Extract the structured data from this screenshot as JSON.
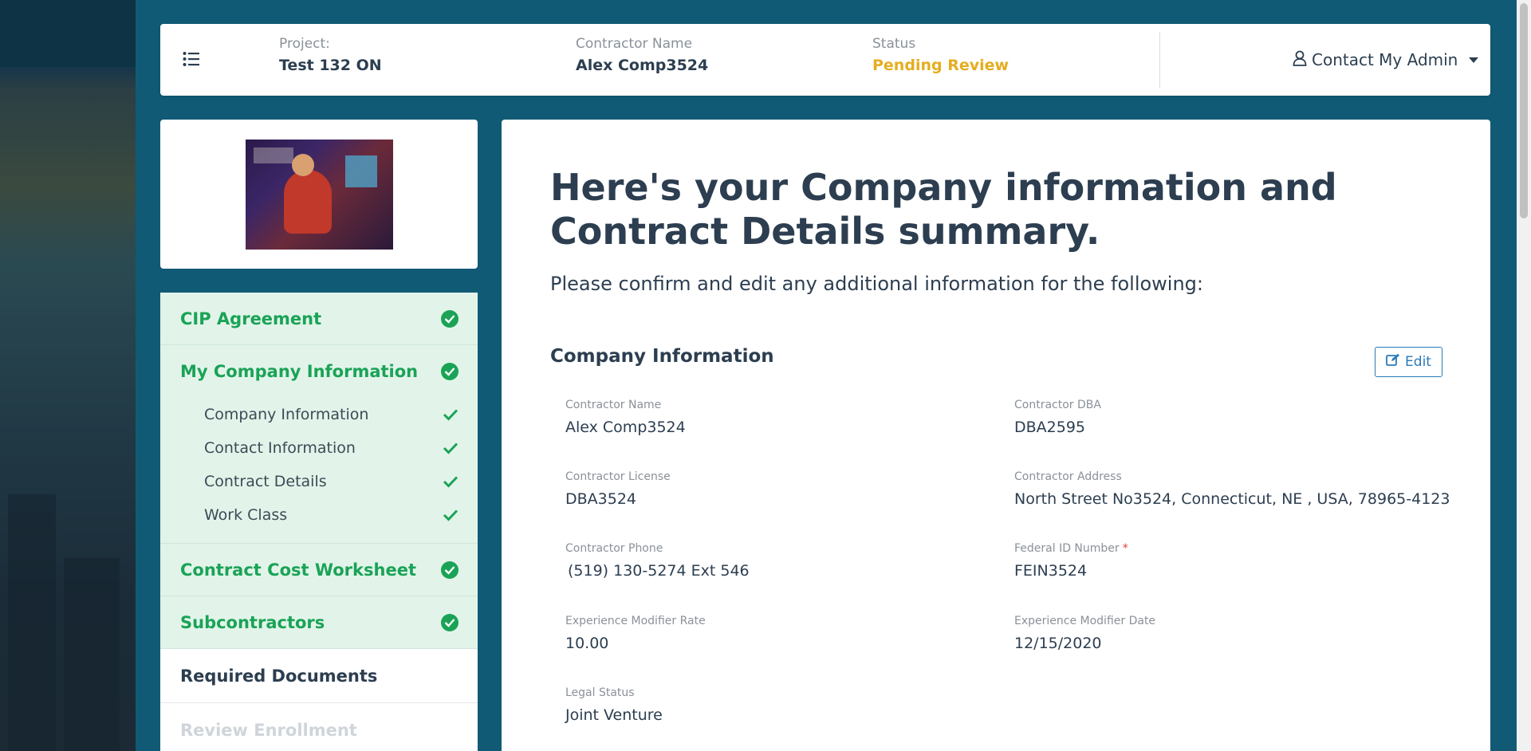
{
  "header": {
    "project_label": "Project:",
    "project_value": "Test 132 ON",
    "contractor_label": "Contractor Name",
    "contractor_value": "Alex Comp3524",
    "status_label": "Status",
    "status_value": "Pending Review",
    "contact_admin": "Contact My Admin"
  },
  "sidebar": {
    "items": [
      {
        "label": "CIP Agreement",
        "status": "complete"
      },
      {
        "label": "My Company Information",
        "status": "complete",
        "subitems": [
          {
            "label": "Company Information"
          },
          {
            "label": "Contact Information"
          },
          {
            "label": "Contract Details"
          },
          {
            "label": "Work Class"
          }
        ]
      },
      {
        "label": "Contract Cost Worksheet",
        "status": "complete"
      },
      {
        "label": "Subcontractors",
        "status": "complete"
      },
      {
        "label": "Required Documents",
        "status": "active"
      },
      {
        "label": "Review Enrollment",
        "status": "disabled"
      }
    ]
  },
  "main": {
    "title": "Here's your Company information and Contract Details summary.",
    "subtitle": "Please confirm and edit any additional information for the following:",
    "section_title": "Company Information",
    "edit_label": "Edit",
    "fields": {
      "contractor_name": {
        "label": "Contractor Name",
        "value": "Alex Comp3524"
      },
      "contractor_dba": {
        "label": "Contractor DBA",
        "value": "DBA2595"
      },
      "contractor_license": {
        "label": "Contractor License",
        "value": "DBA3524"
      },
      "contractor_address": {
        "label": "Contractor Address",
        "value": "North Street No3524, Connecticut, NE , USA, 78965-4123"
      },
      "contractor_phone": {
        "label": "Contractor Phone",
        "value": "(519) 130-5274 Ext 546"
      },
      "federal_id": {
        "label": "Federal ID Number",
        "value": "FEIN3524",
        "required_mark": "*"
      },
      "exp_mod_rate": {
        "label": "Experience Modifier Rate",
        "value": "10.00"
      },
      "exp_mod_date": {
        "label": "Experience Modifier Date",
        "value": "12/15/2020"
      },
      "legal_status": {
        "label": "Legal Status",
        "value": "Joint Venture"
      }
    }
  },
  "colors": {
    "background": "#115a76",
    "complete_green": "#1aa356",
    "complete_bg": "#e2f4ea",
    "pending_yellow": "#e5ad1f",
    "edit_blue": "#2a7ab8"
  }
}
